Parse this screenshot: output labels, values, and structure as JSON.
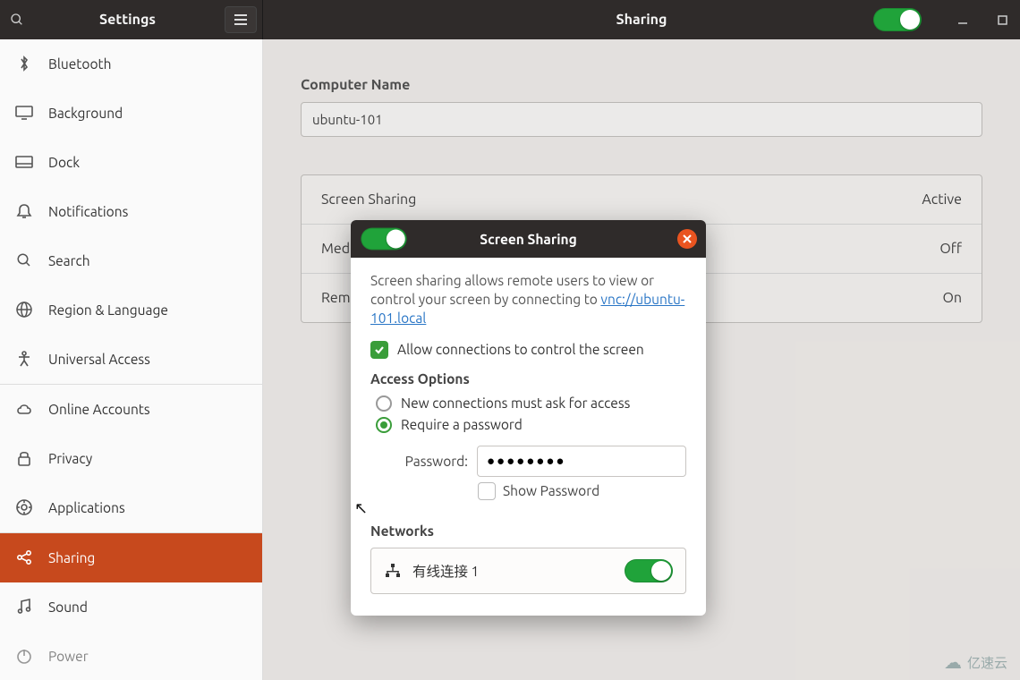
{
  "header": {
    "left_title": "Settings",
    "right_title": "Sharing"
  },
  "sidebar": {
    "items": [
      {
        "label": "Bluetooth",
        "icon": "bluetooth-icon"
      },
      {
        "label": "Background",
        "icon": "display-icon"
      },
      {
        "label": "Dock",
        "icon": "dock-icon"
      },
      {
        "label": "Notifications",
        "icon": "bell-icon"
      },
      {
        "label": "Search",
        "icon": "search-icon"
      },
      {
        "label": "Region & Language",
        "icon": "globe-icon"
      },
      {
        "label": "Universal Access",
        "icon": "accessibility-icon"
      },
      {
        "label": "Online Accounts",
        "icon": "cloud-icon"
      },
      {
        "label": "Privacy",
        "icon": "lock-icon"
      },
      {
        "label": "Applications",
        "icon": "apps-icon"
      },
      {
        "label": "Sharing",
        "icon": "share-icon",
        "selected": true
      },
      {
        "label": "Sound",
        "icon": "music-icon"
      },
      {
        "label": "Power",
        "icon": "power-icon"
      }
    ]
  },
  "main": {
    "computer_name_label": "Computer Name",
    "computer_name_value": "ubuntu-101",
    "share_rows": [
      {
        "label": "Screen Sharing",
        "status": "Active"
      },
      {
        "label": "Media Sharing",
        "status": "Off"
      },
      {
        "label": "Remote Login",
        "status": "On"
      }
    ]
  },
  "dialog": {
    "title": "Screen Sharing",
    "desc_prefix": "Screen sharing allows remote users to view or control your screen by connecting to ",
    "desc_link": "vnc://ubuntu-101.local",
    "allow_control_label": "Allow connections to control the screen",
    "access_options_heading": "Access Options",
    "radio_ask_label": "New connections must ask for access",
    "radio_password_label": "Require a password",
    "password_label": "Password:",
    "password_value": "●●●●●●●●",
    "show_password_label": "Show Password",
    "networks_heading": "Networks",
    "network_name": "有线连接 1"
  },
  "watermark": {
    "text": "亿速云"
  }
}
